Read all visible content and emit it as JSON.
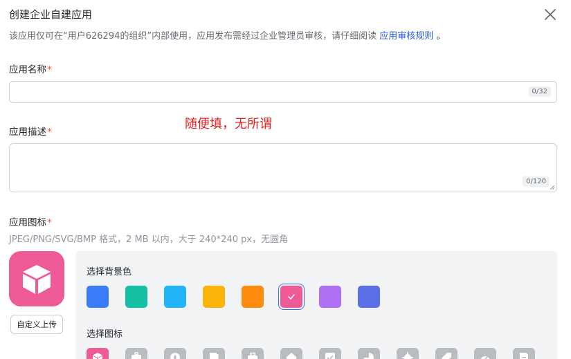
{
  "dialog": {
    "title": "创建企业自建应用",
    "subtitle_prefix": "该应用仅可在“用户626294的组织”内部使用，应用发布需经过企业管理员审核，请仔细阅读",
    "subtitle_link": "应用审核规则",
    "subtitle_suffix": "。"
  },
  "name_field": {
    "label": "应用名称",
    "required_mark": "*",
    "value": "",
    "counter": "0/32"
  },
  "desc_field": {
    "label": "应用描述",
    "required_mark": "*",
    "value": "",
    "counter": "0/120"
  },
  "annotation": "随便填，无所谓",
  "icon_field": {
    "label": "应用图标",
    "required_mark": "*",
    "hint": "JPEG/PNG/SVG/BMP 格式，2 MB 以内，大于 240*240 px，无圆角",
    "upload_label": "自定义上传",
    "preview_color": "#ee5a96",
    "preview_icon": "cube-icon"
  },
  "bg_picker": {
    "title": "选择背景色",
    "colors": [
      "#3a7bfa",
      "#14c0a4",
      "#21b4f7",
      "#fbb40a",
      "#fe8b0d",
      "#ee5a96",
      "#b06ff0",
      "#5a6ee6"
    ],
    "selected_index": 5
  },
  "icon_picker": {
    "title": "选择图标",
    "icons": [
      "cube-icon",
      "briefcase-icon",
      "compass-icon",
      "book-icon",
      "toolbox-icon",
      "house-icon",
      "checkbox-icon",
      "pie-chart-icon",
      "gear-icon",
      "tag-icon",
      "gauge-icon",
      "document-icon"
    ],
    "selected_index": 0
  }
}
